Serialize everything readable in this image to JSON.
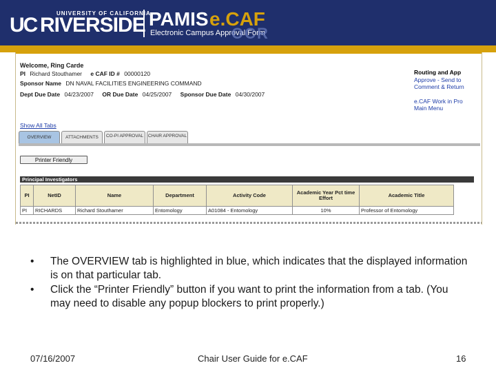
{
  "header": {
    "uc": "UC",
    "university": "UNIVERSITY OF CALIFORNIA",
    "riverside": "RIVERSIDE",
    "pamis": "PAMIS",
    "ecaf": "e.CAF",
    "subtitle": "Electronic Campus Approval Form",
    "ocr": "OCR"
  },
  "ecaf": {
    "welcome": "Welcome, Ring Carde",
    "pi_label": "PI",
    "pi_value": "Richard Stouthamer",
    "caf_id_label": "e CAF ID #",
    "caf_id_value": "00000120",
    "sponsor_label": "Sponsor Name",
    "sponsor_value": "DN NAVAL FACILITIES ENGINEERING COMMAND",
    "dept_due_label": "Dept Due Date",
    "dept_due_value": "04/23/2007",
    "or_due_label": "OR Due Date",
    "or_due_value": "04/25/2007",
    "sponsor_due_label": "Sponsor Due Date",
    "sponsor_due_value": "04/30/2007",
    "routing_title": "Routing and App",
    "routing_links": [
      "Approve - Send to",
      "Comment & Return"
    ],
    "other_links": [
      "e.CAF Work in Pro",
      "Main Menu"
    ],
    "show_all_tabs": "Show All Tabs",
    "tabs": [
      {
        "label": "OVERVIEW"
      },
      {
        "label": "ATTACHMENTS"
      },
      {
        "label": "CO-PI APPROVAL"
      },
      {
        "label": "CHAIR APPROVAL"
      }
    ],
    "printer_friendly": "Printer Friendly",
    "pi_section_title": "Principal Investigators",
    "table": {
      "headers": [
        "PI",
        "NetID",
        "Name",
        "Department",
        "Activity Code",
        "Academic Year Pct time Effort",
        "Academic Title"
      ],
      "rows": [
        [
          "PI",
          "RICHARDS",
          "Richard Stouthamer",
          "Entomology",
          "A01084 - Entomology",
          "10%",
          "Professor of Entomology"
        ]
      ]
    }
  },
  "slide": {
    "bullets": [
      "The OVERVIEW tab is highlighted in blue, which indicates that the displayed information is on that particular tab.",
      "Click the “Printer Friendly” button if you want to print the information from a tab. (You may need to disable any popup blockers to print properly.)"
    ],
    "bullet_glyph": "•",
    "footer_date": "07/16/2007",
    "footer_title": "Chair User Guide for e.CAF",
    "footer_page": "16"
  }
}
